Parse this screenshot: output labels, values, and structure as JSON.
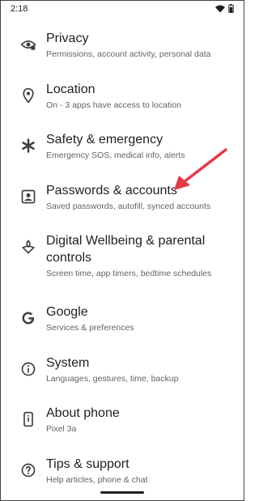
{
  "status_bar": {
    "time": "2:18",
    "icons": [
      "wifi-icon",
      "battery-icon"
    ]
  },
  "settings": {
    "items": [
      {
        "title": "Privacy",
        "subtitle": "Permissions, account activity, personal data",
        "icon": "privacy-eye-icon"
      },
      {
        "title": "Location",
        "subtitle": "On - 3 apps have access to location",
        "icon": "location-pin-icon"
      },
      {
        "title": "Safety & emergency",
        "subtitle": "Emergency SOS, medical info, alerts",
        "icon": "asterisk-icon"
      },
      {
        "title": "Passwords & accounts",
        "subtitle": "Saved passwords, autofill, synced accounts",
        "icon": "account-box-icon"
      },
      {
        "title": "Digital Wellbeing & parental controls",
        "subtitle": "Screen time, app timers, bedtime schedules",
        "icon": "wellbeing-icon"
      },
      {
        "title": "Google",
        "subtitle": "Services & preferences",
        "icon": "google-g-icon"
      },
      {
        "title": "System",
        "subtitle": "Languages, gestures, time, backup",
        "icon": "info-circle-icon"
      },
      {
        "title": "About phone",
        "subtitle": "Pixel 3a",
        "icon": "phone-icon"
      },
      {
        "title": "Tips & support",
        "subtitle": "Help articles, phone & chat",
        "icon": "help-circle-icon"
      }
    ]
  },
  "annotation": {
    "arrow_color": "#e53945"
  },
  "colors": {
    "title": "#1f1f1f",
    "subtitle": "#5f6368",
    "icon": "#3c4043"
  }
}
